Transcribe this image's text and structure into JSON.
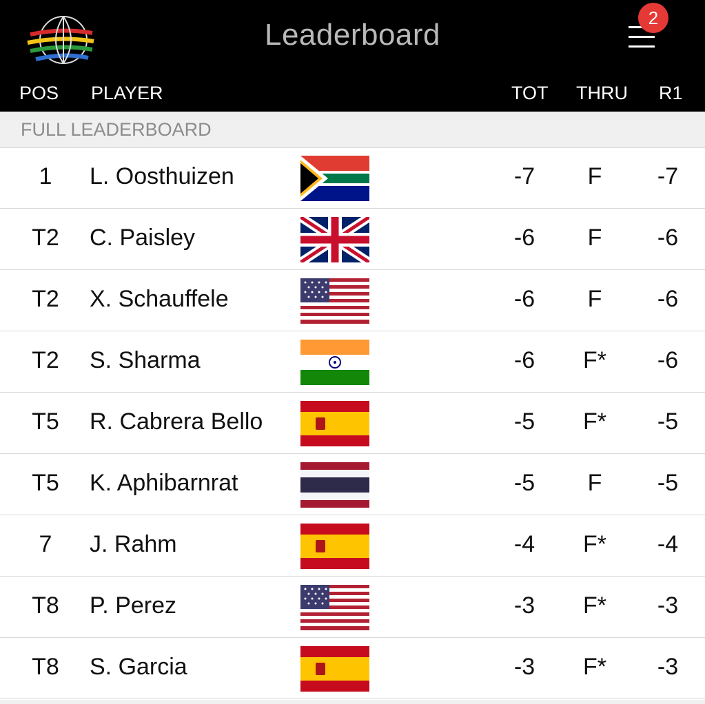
{
  "header": {
    "title": "Leaderboard",
    "notification_count": "2",
    "logo_icon": "wgc-globe-logo-icon",
    "menu_icon": "hamburger-menu-icon"
  },
  "columns": {
    "pos": "POS",
    "player": "PLAYER",
    "tot": "TOT",
    "thru": "THRU",
    "r1": "R1"
  },
  "section_label": "FULL LEADERBOARD",
  "colors": {
    "header_bg": "#000000",
    "badge": "#e53935",
    "section_bg": "#f0f0f0",
    "title": "#b9b9b9"
  },
  "players": [
    {
      "pos": "1",
      "name": "L. Oosthuizen",
      "flag": "south-africa-flag-icon",
      "tot": "-7",
      "thru": "F",
      "r1": "-7"
    },
    {
      "pos": "T2",
      "name": "C. Paisley",
      "flag": "united-kingdom-flag-icon",
      "tot": "-6",
      "thru": "F",
      "r1": "-6"
    },
    {
      "pos": "T2",
      "name": "X. Schauffele",
      "flag": "usa-flag-icon",
      "tot": "-6",
      "thru": "F",
      "r1": "-6"
    },
    {
      "pos": "T2",
      "name": "S. Sharma",
      "flag": "india-flag-icon",
      "tot": "-6",
      "thru": "F*",
      "r1": "-6"
    },
    {
      "pos": "T5",
      "name": "R. Cabrera Bello",
      "flag": "spain-flag-icon",
      "tot": "-5",
      "thru": "F*",
      "r1": "-5"
    },
    {
      "pos": "T5",
      "name": "K. Aphibarnrat",
      "flag": "thailand-flag-icon",
      "tot": "-5",
      "thru": "F",
      "r1": "-5"
    },
    {
      "pos": "7",
      "name": "J. Rahm",
      "flag": "spain-flag-icon",
      "tot": "-4",
      "thru": "F*",
      "r1": "-4"
    },
    {
      "pos": "T8",
      "name": "P. Perez",
      "flag": "usa-flag-icon",
      "tot": "-3",
      "thru": "F*",
      "r1": "-3"
    },
    {
      "pos": "T8",
      "name": "S. Garcia",
      "flag": "spain-flag-icon",
      "tot": "-3",
      "thru": "F*",
      "r1": "-3"
    }
  ]
}
